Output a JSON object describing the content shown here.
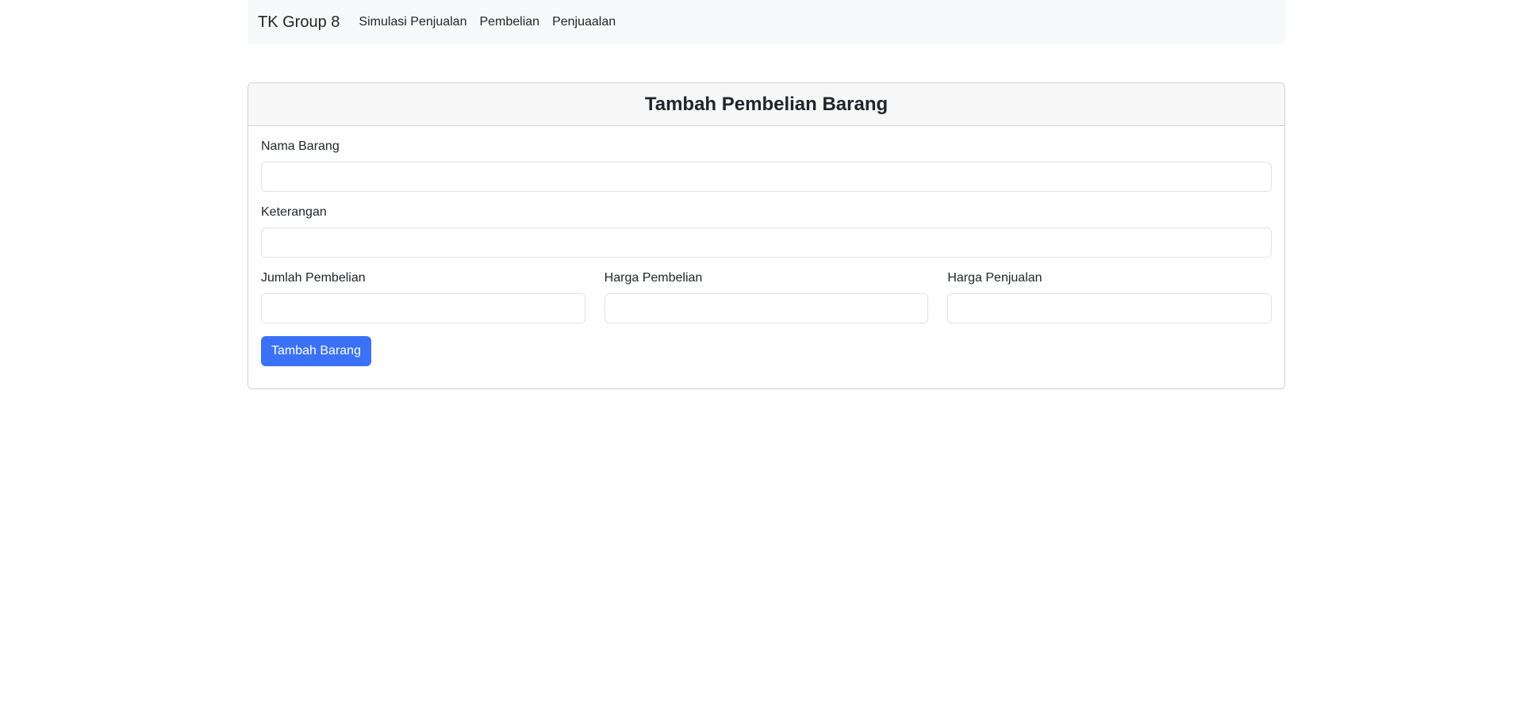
{
  "navbar": {
    "brand": "TK Group 8",
    "links": [
      {
        "label": "Simulasi Penjualan"
      },
      {
        "label": "Pembelian"
      },
      {
        "label": "Penjuaalan"
      }
    ]
  },
  "form": {
    "title": "Tambah Pembelian Barang",
    "fields": {
      "nama_barang": {
        "label": "Nama Barang",
        "value": ""
      },
      "keterangan": {
        "label": "Keterangan",
        "value": ""
      },
      "jumlah_pembelian": {
        "label": "Jumlah Pembelian",
        "value": ""
      },
      "harga_pembelian": {
        "label": "Harga Pembelian",
        "value": ""
      },
      "harga_penjualan": {
        "label": "Harga Penjualan",
        "value": ""
      }
    },
    "submit_label": "Tambah Barang"
  },
  "colors": {
    "primary": "#3b71f7",
    "navbar_bg": "#f8f9fa",
    "card_header_bg": "#f7f7f7",
    "border": "#dee2e6"
  }
}
